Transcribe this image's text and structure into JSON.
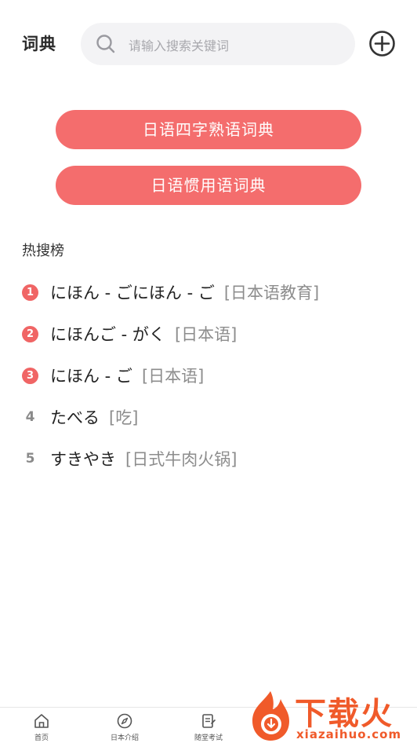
{
  "header": {
    "title": "词典",
    "search_placeholder": "请输入搜索关键词"
  },
  "dictionaries": [
    {
      "label": "日语四字熟语词典"
    },
    {
      "label": "日语惯用语词典"
    }
  ],
  "hot_search": {
    "title": "热搜榜",
    "items": [
      {
        "rank": "1",
        "word": "にほん - ごにほん - ご",
        "meaning": "[日本语教育]"
      },
      {
        "rank": "2",
        "word": "にほんご - がく",
        "meaning": "[日本语]"
      },
      {
        "rank": "3",
        "word": "にほん - ご",
        "meaning": "[日本语]"
      },
      {
        "rank": "4",
        "word": "たべる",
        "meaning": "[吃]"
      },
      {
        "rank": "5",
        "word": "すきやき",
        "meaning": "[日式牛肉火锅]"
      }
    ]
  },
  "tabbar": {
    "tabs": [
      {
        "label": "首页",
        "icon": "home-icon"
      },
      {
        "label": "日本介绍",
        "icon": "compass-icon"
      },
      {
        "label": "随堂考试",
        "icon": "exam-icon"
      }
    ]
  },
  "watermark": {
    "text": "下载火",
    "url": "xiazaihuo.com"
  },
  "colors": {
    "accent": "#f46d6d",
    "badge": "#f06565",
    "watermark": "#f05a2a"
  }
}
